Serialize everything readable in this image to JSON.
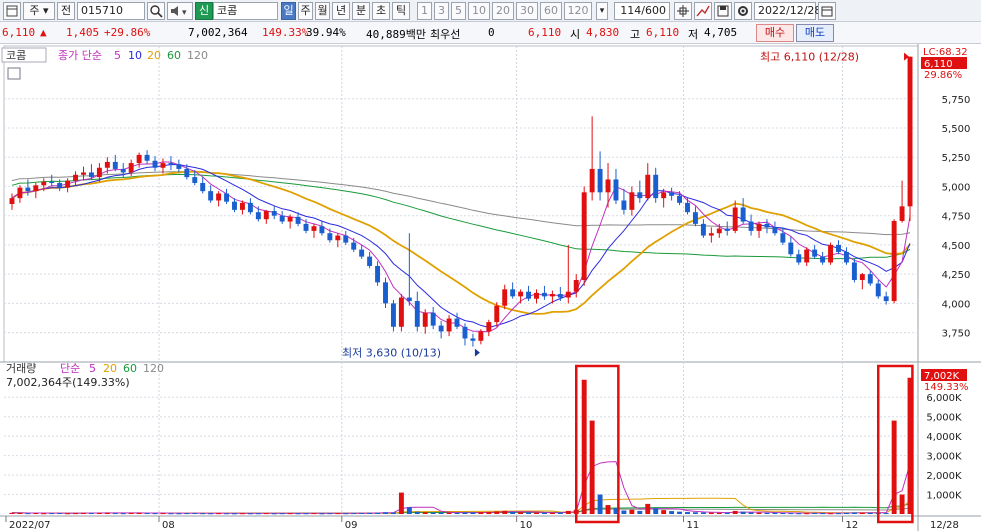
{
  "toolbar": {
    "market": "주",
    "prefix": "전",
    "code": "015710",
    "badge": "신",
    "name": "코콤",
    "periods": [
      "일",
      "주",
      "월",
      "년",
      "분",
      "초",
      "틱"
    ],
    "active_period": "일",
    "intervals": [
      "1",
      "3",
      "5",
      "10",
      "20",
      "30",
      "60",
      "120"
    ],
    "count": "114/600",
    "date": "2022/12/28"
  },
  "quote": {
    "price": "6,110",
    "change": "1,405",
    "change_pct": "+29.86%",
    "volume": "7,002,364",
    "volume_ratio": "149.33%",
    "turnover": "39.94%",
    "amount": "40,889백만",
    "pref_label": "최우선",
    "pref_value": "0",
    "ask": "6,110",
    "open_label": "시",
    "open": "4,830",
    "high_label": "고",
    "high": "6,110",
    "low_label": "저",
    "low": "4,705",
    "buy_label": "매수",
    "sell_label": "매도"
  },
  "colors": {
    "up": "#e01010",
    "down": "#1a5fcf",
    "ma5": "#c030c0",
    "ma10": "#2a2ae0",
    "ma20": "#e0a000",
    "ma60": "#1a9a3a",
    "ma120": "#8a8a8a"
  },
  "chart_data": [
    {
      "type": "candlestick",
      "legend": {
        "name": "코콤",
        "label": "종가 단순",
        "periods": [
          "5",
          "10",
          "20",
          "60",
          "120"
        ]
      },
      "ylim": [
        3550,
        6150
      ],
      "y_ticks": [
        "3,750",
        "4,000",
        "4,250",
        "4,500",
        "4,750",
        "5,000",
        "5,250",
        "5,500",
        "5,750"
      ],
      "y_label_top": "29.86%",
      "y_label_prev": "LC:68.32",
      "current_label": "6,110",
      "x_ticks": [
        "2022/07",
        "08",
        "09",
        "10",
        "11",
        "12",
        "12/28"
      ],
      "annotations": {
        "high": "최고 6,110 (12/28)",
        "low": "최저 3,630 (10/13)"
      },
      "ohlc": [
        [
          4850,
          4940,
          4800,
          4900
        ],
        [
          4900,
          5010,
          4860,
          4990
        ],
        [
          4990,
          5060,
          4920,
          4960
        ],
        [
          4960,
          5030,
          4900,
          5010
        ],
        [
          5010,
          5070,
          4960,
          5040
        ],
        [
          5040,
          5100,
          5000,
          5030
        ],
        [
          5030,
          5060,
          4960,
          4990
        ],
        [
          4990,
          5070,
          4950,
          5050
        ],
        [
          5050,
          5130,
          5010,
          5100
        ],
        [
          5100,
          5170,
          5050,
          5120
        ],
        [
          5120,
          5190,
          5060,
          5080
        ],
        [
          5080,
          5200,
          5040,
          5160
        ],
        [
          5160,
          5250,
          5110,
          5210
        ],
        [
          5210,
          5270,
          5130,
          5150
        ],
        [
          5150,
          5200,
          5080,
          5120
        ],
        [
          5120,
          5230,
          5090,
          5200
        ],
        [
          5200,
          5290,
          5160,
          5270
        ],
        [
          5270,
          5310,
          5190,
          5220
        ],
        [
          5220,
          5260,
          5130,
          5160
        ],
        [
          5160,
          5240,
          5110,
          5200
        ],
        [
          5200,
          5260,
          5140,
          5190
        ],
        [
          5190,
          5230,
          5120,
          5150
        ],
        [
          5150,
          5190,
          5060,
          5080
        ],
        [
          5080,
          5140,
          5010,
          5030
        ],
        [
          5030,
          5080,
          4940,
          4960
        ],
        [
          4960,
          5010,
          4860,
          4880
        ],
        [
          4880,
          4960,
          4830,
          4940
        ],
        [
          4940,
          4980,
          4850,
          4870
        ],
        [
          4870,
          4900,
          4780,
          4800
        ],
        [
          4800,
          4880,
          4760,
          4860
        ],
        [
          4860,
          4900,
          4760,
          4780
        ],
        [
          4780,
          4830,
          4700,
          4720
        ],
        [
          4720,
          4800,
          4680,
          4790
        ],
        [
          4790,
          4830,
          4720,
          4750
        ],
        [
          4750,
          4790,
          4680,
          4700
        ],
        [
          4700,
          4760,
          4640,
          4740
        ],
        [
          4740,
          4780,
          4660,
          4680
        ],
        [
          4680,
          4720,
          4600,
          4620
        ],
        [
          4620,
          4680,
          4560,
          4660
        ],
        [
          4660,
          4700,
          4580,
          4600
        ],
        [
          4600,
          4640,
          4520,
          4540
        ],
        [
          4540,
          4600,
          4480,
          4580
        ],
        [
          4580,
          4620,
          4500,
          4520
        ],
        [
          4520,
          4560,
          4440,
          4460
        ],
        [
          4460,
          4500,
          4380,
          4400
        ],
        [
          4400,
          4440,
          4300,
          4320
        ],
        [
          4320,
          4360,
          4150,
          4180
        ],
        [
          4180,
          4220,
          3960,
          4000
        ],
        [
          4000,
          4030,
          3760,
          3800
        ],
        [
          3800,
          4080,
          3760,
          4050
        ],
        [
          4050,
          4600,
          3980,
          4020
        ],
        [
          4020,
          4100,
          3760,
          3800
        ],
        [
          3800,
          3950,
          3740,
          3920
        ],
        [
          3920,
          3970,
          3780,
          3810
        ],
        [
          3810,
          3850,
          3700,
          3760
        ],
        [
          3760,
          3900,
          3720,
          3870
        ],
        [
          3870,
          3920,
          3780,
          3800
        ],
        [
          3800,
          3830,
          3640,
          3700
        ],
        [
          3700,
          3740,
          3630,
          3680
        ],
        [
          3680,
          3780,
          3650,
          3760
        ],
        [
          3760,
          3860,
          3720,
          3840
        ],
        [
          3840,
          4010,
          3800,
          3980
        ],
        [
          3980,
          4160,
          3950,
          4120
        ],
        [
          4120,
          4180,
          4040,
          4060
        ],
        [
          4060,
          4120,
          4000,
          4100
        ],
        [
          4100,
          4150,
          4020,
          4040
        ],
        [
          4040,
          4120,
          4000,
          4090
        ],
        [
          4090,
          4150,
          4030,
          4060
        ],
        [
          4060,
          4110,
          4000,
          4080
        ],
        [
          4080,
          4140,
          4020,
          4050
        ],
        [
          4050,
          4500,
          4000,
          4100
        ],
        [
          4100,
          4250,
          4050,
          4200
        ],
        [
          4200,
          5000,
          4150,
          4950
        ],
        [
          4950,
          5600,
          4880,
          5150
        ],
        [
          5150,
          5300,
          4880,
          4950
        ],
        [
          4950,
          5200,
          4820,
          5060
        ],
        [
          5060,
          5150,
          4850,
          4880
        ],
        [
          4880,
          4980,
          4760,
          4800
        ],
        [
          4800,
          5000,
          4750,
          4950
        ],
        [
          4950,
          5050,
          4860,
          4900
        ],
        [
          4900,
          5200,
          4880,
          5100
        ],
        [
          5100,
          5160,
          4860,
          4900
        ],
        [
          4900,
          4980,
          4820,
          4950
        ],
        [
          4950,
          4990,
          4880,
          4920
        ],
        [
          4920,
          4960,
          4840,
          4860
        ],
        [
          4860,
          4900,
          4760,
          4780
        ],
        [
          4780,
          4830,
          4660,
          4680
        ],
        [
          4680,
          4720,
          4560,
          4580
        ],
        [
          4580,
          4650,
          4520,
          4600
        ],
        [
          4600,
          4680,
          4560,
          4640
        ],
        [
          4640,
          4700,
          4580,
          4620
        ],
        [
          4620,
          4880,
          4600,
          4820
        ],
        [
          4820,
          4900,
          4680,
          4700
        ],
        [
          4700,
          4760,
          4580,
          4620
        ],
        [
          4620,
          4700,
          4560,
          4680
        ],
        [
          4680,
          4720,
          4600,
          4650
        ],
        [
          4650,
          4700,
          4580,
          4600
        ],
        [
          4600,
          4650,
          4500,
          4520
        ],
        [
          4520,
          4570,
          4400,
          4420
        ],
        [
          4420,
          4460,
          4330,
          4350
        ],
        [
          4350,
          4480,
          4320,
          4460
        ],
        [
          4460,
          4500,
          4380,
          4400
        ],
        [
          4400,
          4440,
          4330,
          4350
        ],
        [
          4350,
          4520,
          4330,
          4500
        ],
        [
          4500,
          4540,
          4420,
          4440
        ],
        [
          4440,
          4480,
          4330,
          4350
        ],
        [
          4350,
          4380,
          4180,
          4200
        ],
        [
          4200,
          4260,
          4120,
          4250
        ],
        [
          4250,
          4280,
          4150,
          4170
        ],
        [
          4170,
          4200,
          4040,
          4060
        ],
        [
          4060,
          4100,
          3990,
          4020
        ],
        [
          4020,
          4720,
          4000,
          4705
        ],
        [
          4705,
          5050,
          4690,
          4830
        ],
        [
          4830,
          6110,
          4705,
          6110
        ]
      ]
    },
    {
      "type": "bar",
      "legend": {
        "name": "거래량",
        "label": "단순",
        "periods": [
          "5",
          "20",
          "60",
          "120"
        ]
      },
      "ylim": [
        0,
        7400
      ],
      "y_ticks": [
        "1,000K",
        "2,000K",
        "3,000K",
        "4,000K",
        "5,000K",
        "6,000K"
      ],
      "current_label": "7,002K",
      "ratio_label": "149.33%",
      "summary": "7,002,364주(149.33%)",
      "highlight_ranges": [
        [
          72,
          76
        ],
        [
          110,
          113
        ]
      ],
      "values_k": [
        60,
        55,
        45,
        50,
        40,
        48,
        52,
        40,
        46,
        58,
        55,
        60,
        66,
        50,
        42,
        58,
        62,
        50,
        44,
        48,
        40,
        38,
        46,
        50,
        42,
        38,
        44,
        40,
        36,
        42,
        38,
        40,
        46,
        36,
        42,
        44,
        38,
        40,
        46,
        36,
        42,
        46,
        40,
        48,
        52,
        58,
        66,
        90,
        80,
        1100,
        350,
        120,
        90,
        80,
        70,
        66,
        60,
        80,
        76,
        90,
        100,
        130,
        160,
        110,
        90,
        80,
        70,
        66,
        60,
        80,
        160,
        220,
        6900,
        4800,
        1000,
        460,
        300,
        180,
        220,
        160,
        520,
        300,
        200,
        150,
        120,
        100,
        90,
        80,
        70,
        60,
        66,
        160,
        120,
        80,
        70,
        60,
        66,
        50,
        46,
        40,
        42,
        50,
        46,
        40,
        44,
        60,
        80,
        70,
        60,
        52,
        48,
        4800,
        1000,
        7002
      ]
    }
  ]
}
